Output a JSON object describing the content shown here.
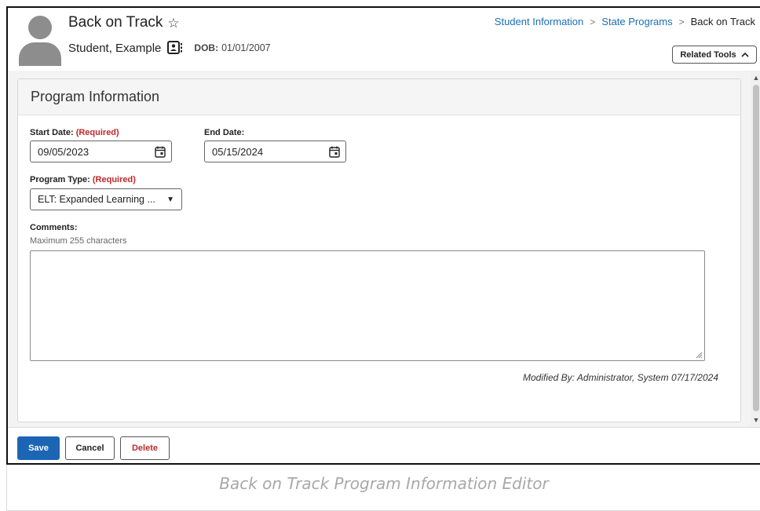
{
  "header": {
    "title": "Back on Track",
    "student_name": "Student, Example",
    "dob_label": "DOB:",
    "dob_value": "01/01/2007",
    "related_tools_label": "Related Tools"
  },
  "breadcrumb": {
    "items": [
      "Student Information",
      "State Programs"
    ],
    "current": "Back on Track"
  },
  "panel": {
    "title": "Program Information",
    "start_date": {
      "label": "Start Date:",
      "required": "(Required)",
      "value": "09/05/2023"
    },
    "end_date": {
      "label": "End Date:",
      "value": "05/15/2024"
    },
    "program_type": {
      "label": "Program Type:",
      "required": "(Required)",
      "value": "ELT: Expanded Learning ..."
    },
    "comments": {
      "label": "Comments:",
      "hint": "Maximum 255 characters",
      "value": ""
    },
    "modified_by": "Modified By: Administrator, System 07/17/2024"
  },
  "footer": {
    "save_label": "Save",
    "cancel_label": "Cancel",
    "delete_label": "Delete"
  },
  "caption": "Back on Track Program Information Editor",
  "colors": {
    "link": "#1a6fb5",
    "primary": "#1c65b5",
    "required": "#c0282d"
  },
  "icons": [
    "star-icon",
    "contact-card-icon",
    "chevron-up-icon",
    "calendar-icon",
    "dropdown-arrow-icon",
    "resize-grip-icon",
    "breadcrumb-separator-icon"
  ]
}
